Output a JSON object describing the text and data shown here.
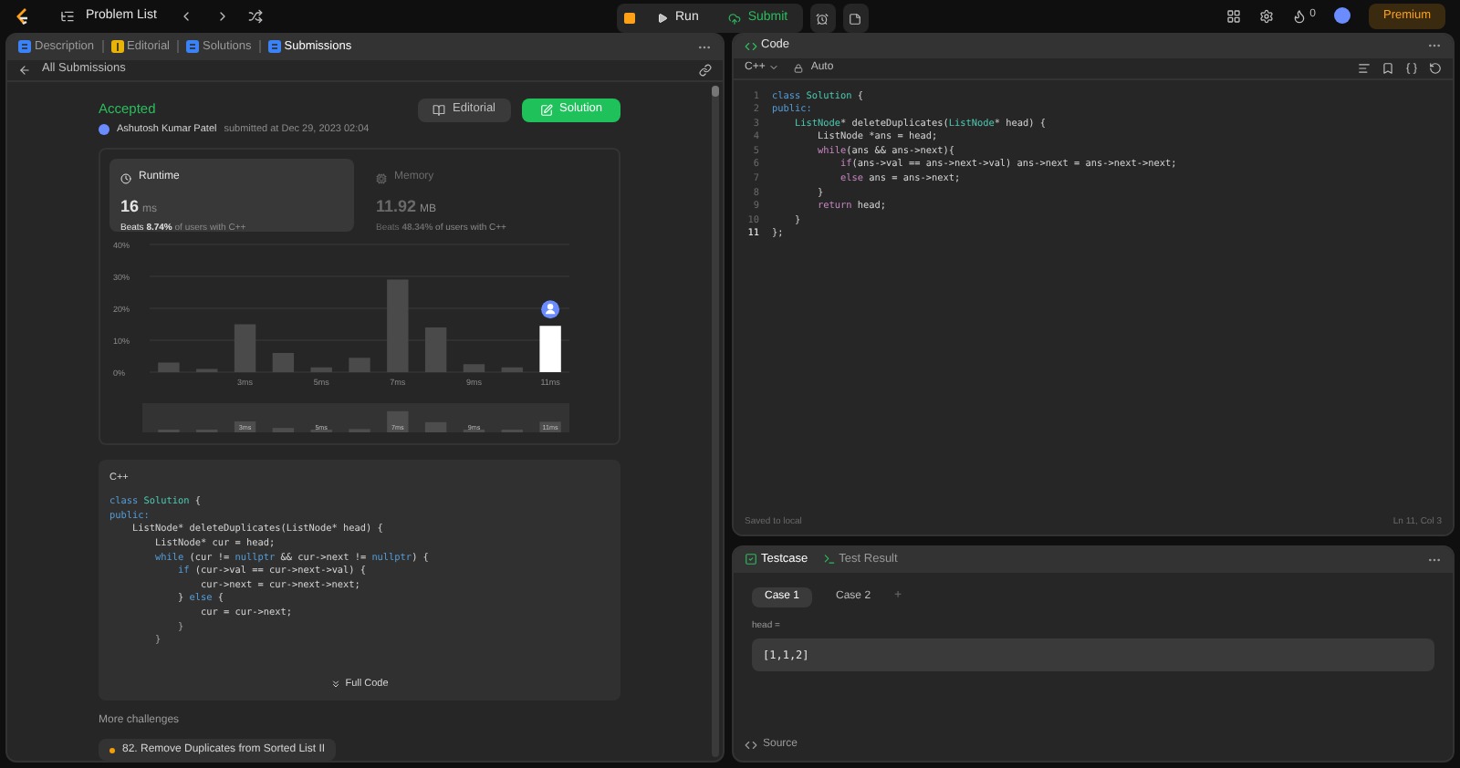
{
  "top_bar": {
    "problem_list": "Problem List",
    "run": "Run",
    "submit": "Submit",
    "streak": "0",
    "premium": "Premium"
  },
  "left_tabs": [
    {
      "label": "Description",
      "selected": false,
      "color": "#3b82f6"
    },
    {
      "label": "Editorial",
      "selected": false,
      "color": "#eab308"
    },
    {
      "label": "Solutions",
      "selected": false,
      "color": "#3b82f6"
    },
    {
      "label": "Submissions",
      "selected": true,
      "color": "#3b82f6"
    }
  ],
  "back_link": "All Submissions",
  "submission": {
    "status": "Accepted",
    "author": "Ashutosh Kumar Patel",
    "submitted": "submitted at Dec 29, 2023 02:04",
    "editorial_button": "Editorial",
    "solution_button": "Solution"
  },
  "stats": [
    {
      "title": "Runtime",
      "value": "16",
      "unit": "ms",
      "beats_prefix": "Beats",
      "beats": "8.74%",
      "beats_suffix": "of users with C++",
      "selected": true
    },
    {
      "title": "Memory",
      "value": "11.92",
      "unit": "MB",
      "beats_prefix": "Beats",
      "beats": "48.34%",
      "beats_suffix": "of users with C++",
      "selected": false
    }
  ],
  "chart_data": {
    "type": "bar",
    "categories": [
      null,
      null,
      "3ms",
      null,
      "5ms",
      null,
      "7ms",
      null,
      "9ms",
      null,
      "11ms"
    ],
    "stacked": true,
    "grid": true,
    "ylim": [
      0,
      40
    ],
    "yticks": [
      {
        "value": 0,
        "label": "0%"
      },
      {
        "value": 10,
        "label": "10%"
      },
      {
        "value": 20,
        "label": "20%"
      },
      {
        "value": 30,
        "label": "30%"
      },
      {
        "value": 40,
        "label": "40%"
      }
    ],
    "series": [
      {
        "color": "#4a4a4a",
        "values": [
          3,
          1,
          15,
          6,
          1.5,
          4.5,
          29,
          14,
          2.5,
          1.5,
          null
        ]
      },
      {
        "color": "#ffffff",
        "values": [
          null,
          null,
          null,
          null,
          null,
          null,
          null,
          null,
          null,
          null,
          14.5
        ]
      }
    ]
  },
  "brush_labels": [
    "3ms",
    "5ms",
    "7ms",
    "9ms",
    "11ms"
  ],
  "snippet": {
    "language": "C++",
    "full_code": "Full Code",
    "lines": [
      [
        {
          "kind": "kw",
          "text": "class "
        },
        {
          "kind": "type",
          "text": "Solution"
        },
        {
          "kind": "plain",
          "text": " {"
        }
      ],
      [
        {
          "kind": "kw",
          "text": "public:"
        }
      ],
      [
        {
          "kind": "plain",
          "text": "    ListNode* deleteDuplicates(ListNode* head) {"
        }
      ],
      [
        {
          "kind": "plain",
          "text": "        ListNode* cur = head;"
        }
      ],
      [
        {
          "kind": "kw",
          "text": "        while"
        },
        {
          "kind": "plain",
          "text": " (cur != "
        },
        {
          "kind": "kw",
          "text": "nullptr"
        },
        {
          "kind": "plain",
          "text": " && cur->next != "
        },
        {
          "kind": "kw",
          "text": "nullptr"
        },
        {
          "kind": "plain",
          "text": ") {"
        }
      ],
      [
        {
          "kind": "kw",
          "text": "            if"
        },
        {
          "kind": "plain",
          "text": " (cur->val == cur->next->val) {"
        }
      ],
      [
        {
          "kind": "plain",
          "text": "                cur->next = cur->next->next;"
        }
      ],
      [
        {
          "kind": "plain",
          "text": "            } "
        },
        {
          "kind": "kw",
          "text": "else"
        },
        {
          "kind": "plain",
          "text": " {"
        }
      ],
      [
        {
          "kind": "plain",
          "text": "                cur = cur->next;"
        }
      ],
      [
        {
          "kind": "plain",
          "text": "            }"
        }
      ],
      [
        {
          "kind": "plain",
          "text": "        }"
        }
      ]
    ]
  },
  "more_challenges": {
    "title": "More challenges",
    "items": [
      {
        "label": "82. Remove Duplicates from Sorted List II",
        "color": "#f59e0b"
      }
    ]
  },
  "code_panel": {
    "title": "Code",
    "language": "C++",
    "mode": "Auto",
    "saved": "Saved to local",
    "cursor": "Ln 11, Col 3",
    "lines": [
      {
        "number": "1",
        "tokens": [
          {
            "kind": "kw",
            "text": "class "
          },
          {
            "kind": "type",
            "text": "Solution"
          },
          {
            "kind": "plain",
            "text": " {"
          }
        ]
      },
      {
        "number": "2",
        "tokens": [
          {
            "kind": "kw",
            "text": "public:"
          }
        ]
      },
      {
        "number": "3",
        "tokens": [
          {
            "kind": "type",
            "text": "    ListNode"
          },
          {
            "kind": "plain",
            "text": "* deleteDuplicates("
          },
          {
            "kind": "type",
            "text": "ListNode"
          },
          {
            "kind": "plain",
            "text": "* head) {"
          }
        ]
      },
      {
        "number": "4",
        "tokens": [
          {
            "kind": "plain",
            "text": "        ListNode *ans = head;"
          }
        ]
      },
      {
        "number": "5",
        "tokens": [
          {
            "kind": "ctl",
            "text": "        while"
          },
          {
            "kind": "plain",
            "text": "(ans && ans->next){"
          }
        ]
      },
      {
        "number": "6",
        "tokens": [
          {
            "kind": "ctl",
            "text": "            if"
          },
          {
            "kind": "plain",
            "text": "(ans->val == ans->next->val) ans->next = ans->next->next;"
          }
        ]
      },
      {
        "number": "7",
        "tokens": [
          {
            "kind": "ctl",
            "text": "            else"
          },
          {
            "kind": "plain",
            "text": " ans = ans->next;"
          }
        ]
      },
      {
        "number": "8",
        "tokens": [
          {
            "kind": "plain",
            "text": "        }"
          }
        ]
      },
      {
        "number": "9",
        "tokens": [
          {
            "kind": "ctl",
            "text": "        return"
          },
          {
            "kind": "plain",
            "text": " head;"
          }
        ]
      },
      {
        "number": "10",
        "tokens": [
          {
            "kind": "plain",
            "text": "    }"
          }
        ]
      },
      {
        "number": "11",
        "tokens": [
          {
            "kind": "plain",
            "text": "};"
          }
        ]
      }
    ]
  },
  "test_panel": {
    "tabs": [
      {
        "label": "Testcase",
        "selected": true
      },
      {
        "label": "Test Result",
        "selected": false
      }
    ],
    "cases": [
      {
        "label": "Case 1",
        "selected": true
      },
      {
        "label": "Case 2",
        "selected": false
      }
    ],
    "add_case": "+",
    "input_label": "head =",
    "input_value": "[1,1,2]",
    "source": "Source"
  }
}
